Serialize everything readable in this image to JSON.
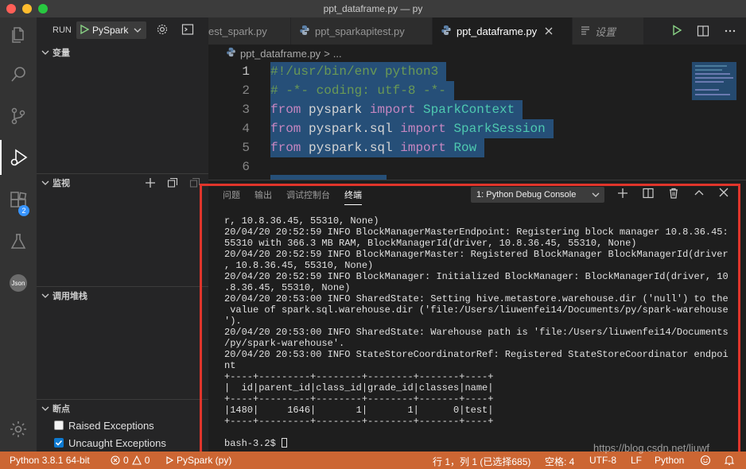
{
  "window": {
    "title": "ppt_dataframe.py — py"
  },
  "activity_bar": {
    "badge_count": "2"
  },
  "sidebar": {
    "run_label": "RUN",
    "run_config": "PySpark",
    "sections": {
      "variables": "变量",
      "watch": "监视",
      "call_stack": "调用堆栈",
      "breakpoints": "断点"
    },
    "breakpoints": [
      {
        "label": "Raised Exceptions",
        "checked": false
      },
      {
        "label": "Uncaught Exceptions",
        "checked": true
      }
    ]
  },
  "tabs": [
    {
      "label": "est_spark.py",
      "active": false
    },
    {
      "label": "ppt_sparkapitest.py",
      "active": false
    },
    {
      "label": "ppt_dataframe.py",
      "active": true
    },
    {
      "label": "设置",
      "active": false
    }
  ],
  "breadcrumb": {
    "file": "ppt_dataframe.py",
    "separator": ">",
    "rest": "..."
  },
  "code": {
    "lines": [
      {
        "num": "1",
        "tokens": [
          {
            "t": "#!/usr/bin/env python3",
            "c": "c-com"
          }
        ]
      },
      {
        "num": "2",
        "tokens": [
          {
            "t": "# -*- coding: utf-8 -*-",
            "c": "c-com"
          }
        ]
      },
      {
        "num": "3",
        "tokens": [
          {
            "t": "from",
            "c": "c-kw"
          },
          {
            "t": " pyspark ",
            "c": "c-id"
          },
          {
            "t": "import",
            "c": "c-kw"
          },
          {
            "t": " SparkContext",
            "c": "c-cls"
          }
        ]
      },
      {
        "num": "4",
        "tokens": [
          {
            "t": "from",
            "c": "c-kw"
          },
          {
            "t": " pyspark.sql ",
            "c": "c-id"
          },
          {
            "t": "import",
            "c": "c-kw"
          },
          {
            "t": " SparkSession",
            "c": "c-cls"
          }
        ]
      },
      {
        "num": "5",
        "tokens": [
          {
            "t": "from",
            "c": "c-kw"
          },
          {
            "t": " pyspark.sql ",
            "c": "c-id"
          },
          {
            "t": "import",
            "c": "c-kw"
          },
          {
            "t": " Row",
            "c": "c-cls"
          }
        ]
      },
      {
        "num": "6",
        "tokens": [
          {
            "t": " ",
            "c": "c-id"
          }
        ]
      }
    ]
  },
  "panel": {
    "tabs": [
      {
        "label": "问题",
        "active": false
      },
      {
        "label": "输出",
        "active": false
      },
      {
        "label": "调试控制台",
        "active": false
      },
      {
        "label": "终端",
        "active": true
      }
    ],
    "console_select": "1: Python Debug Console",
    "terminal_lines": [
      "r, 10.8.36.45, 55310, None)",
      "20/04/20 20:52:59 INFO BlockManagerMasterEndpoint: Registering block manager 10.8.36.45:",
      "55310 with 366.3 MB RAM, BlockManagerId(driver, 10.8.36.45, 55310, None)",
      "20/04/20 20:52:59 INFO BlockManagerMaster: Registered BlockManager BlockManagerId(driver",
      ", 10.8.36.45, 55310, None)",
      "20/04/20 20:52:59 INFO BlockManager: Initialized BlockManager: BlockManagerId(driver, 10",
      ".8.36.45, 55310, None)",
      "20/04/20 20:53:00 INFO SharedState: Setting hive.metastore.warehouse.dir ('null') to the",
      " value of spark.sql.warehouse.dir ('file:/Users/liuwenfei14/Documents/py/spark-warehouse",
      "').",
      "20/04/20 20:53:00 INFO SharedState: Warehouse path is 'file:/Users/liuwenfei14/Documents",
      "/py/spark-warehouse'.",
      "20/04/20 20:53:00 INFO StateStoreCoordinatorRef: Registered StateStoreCoordinator endpoi",
      "nt",
      "+----+---------+--------+--------+-------+----+",
      "|  id|parent_id|class_id|grade_id|classes|name|",
      "+----+---------+--------+--------+-------+----+",
      "|1480|     1646|       1|       1|      0|test|",
      "+----+---------+--------+--------+-------+----+",
      ""
    ],
    "prompt": "bash-3.2$ "
  },
  "status_bar": {
    "python": "Python 3.8.1 64-bit",
    "errors": "0",
    "warnings": "0",
    "debug_config": "PySpark (py)",
    "cursor_pos": "行 1，列 1 (已选择685)",
    "indent": "空格: 4",
    "encoding": "UTF-8",
    "eol": "LF",
    "language": "Python"
  },
  "watermark": "https://blog.csdn.net/liuwf",
  "colors": {
    "status_bar": "#cc6633",
    "selection": "#264f78",
    "highlight_frame": "#e0352b"
  }
}
